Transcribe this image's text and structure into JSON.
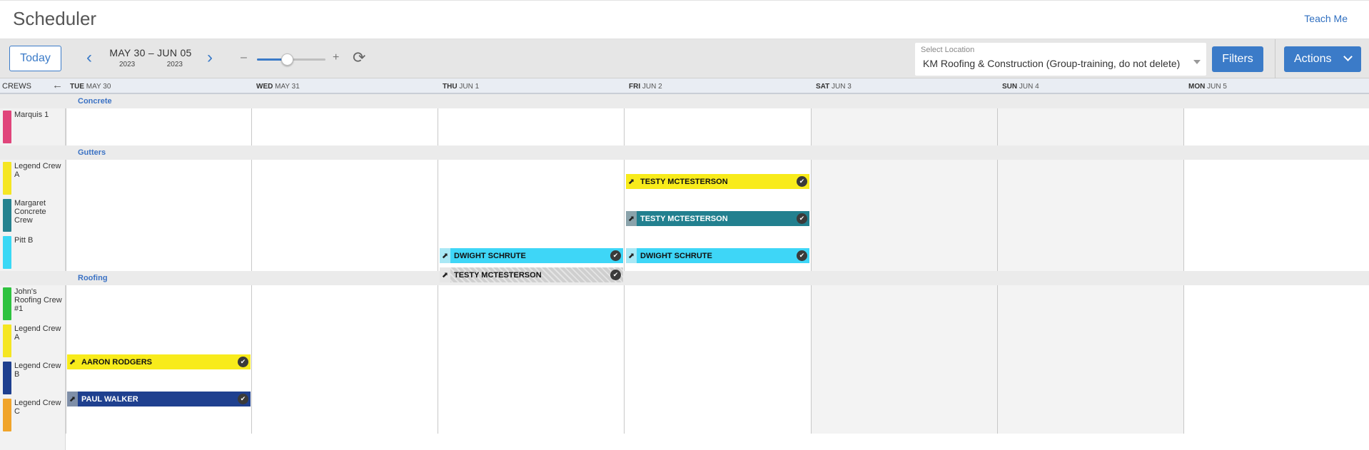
{
  "header": {
    "title": "Scheduler",
    "teach_me": "Teach Me"
  },
  "toolbar": {
    "today": "Today",
    "prev_icon": "chevron-left-icon",
    "next_icon": "chevron-right-icon",
    "range": "MAY 30  –  JUN 05",
    "start_year": "2023",
    "end_year": "2023",
    "zoom_minus": "–",
    "zoom_plus": "+",
    "zoom_level": 0.44,
    "refresh_icon": "refresh-icon",
    "location_label": "Select Location",
    "location_value": "KM Roofing & Construction (Group-training, do not delete)",
    "filters": "Filters",
    "actions": "Actions"
  },
  "calendar": {
    "crews_label": "CREWS",
    "collapse_icon": "arrow-left-icon",
    "days": [
      {
        "dow": "TUE",
        "date": "MAY 30"
      },
      {
        "dow": "WED",
        "date": "MAY 31"
      },
      {
        "dow": "THU",
        "date": "JUN 1"
      },
      {
        "dow": "FRI",
        "date": "JUN 2"
      },
      {
        "dow": "SAT",
        "date": "JUN 3"
      },
      {
        "dow": "SUN",
        "date": "JUN 4"
      },
      {
        "dow": "MON",
        "date": "JUN 5"
      }
    ],
    "groups": [
      {
        "name": "Concrete",
        "crews": [
          {
            "name": "Marquis 1",
            "color": "#e0457b"
          }
        ]
      },
      {
        "name": "Gutters",
        "crews": [
          {
            "name": "Legend Crew A",
            "color": "#f5e623"
          },
          {
            "name": "Margaret Concrete Crew",
            "color": "#25828f"
          },
          {
            "name": "Pitt B",
            "color": "#3ad8f5"
          }
        ]
      },
      {
        "name": "Roofing",
        "crews": [
          {
            "name": "John's Roofing Crew #1",
            "color": "#2ec23f"
          },
          {
            "name": "Legend Crew A",
            "color": "#f5e623"
          },
          {
            "name": "Legend Crew B",
            "color": "#1e3f8f"
          },
          {
            "name": "Legend Crew C",
            "color": "#f0a42a"
          }
        ]
      }
    ],
    "events": [
      {
        "name": "TESTY MCTESTERSON",
        "day": 3,
        "span": 1,
        "color": "#f8eb1b",
        "handle": "#f8eb1b",
        "text": "#111111",
        "hatched": false
      },
      {
        "name": "TESTY MCTESTERSON",
        "day": 3,
        "span": 1,
        "color": "#22808f",
        "handle": "#8aa3ab",
        "text": "#ffffff",
        "hatched": false
      },
      {
        "name": "DWIGHT SCHRUTE",
        "day": 2,
        "span": 1,
        "color": "#3ed6f7",
        "handle": "#a9e8f5",
        "text": "#111111",
        "hatched": false
      },
      {
        "name": "DWIGHT SCHRUTE",
        "day": 3,
        "span": 1,
        "color": "#3ed6f7",
        "handle": "#a9e8f5",
        "text": "#111111",
        "hatched": false
      },
      {
        "name": "TESTY MCTESTERSON",
        "day": 2,
        "span": 1,
        "color": "#cfcfcf",
        "handle": "#e6e6e6",
        "text": "#111111",
        "hatched": true
      },
      {
        "name": "AARON RODGERS",
        "day": 0,
        "span": 1,
        "color": "#f8eb1b",
        "handle": "#f8eb1b",
        "text": "#111111",
        "hatched": false
      },
      {
        "name": "PAUL WALKER",
        "day": 0,
        "span": 1,
        "color": "#1f408f",
        "handle": "#7f8fa8",
        "text": "#ffffff",
        "hatched": false
      }
    ],
    "handle_icon": "drag-handle-icon",
    "check_icon": "check-circle-icon"
  }
}
